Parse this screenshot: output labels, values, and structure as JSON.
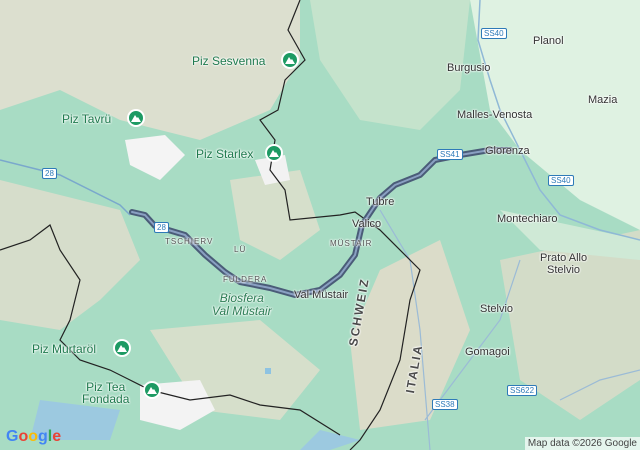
{
  "places": {
    "planol": "Planol",
    "burgusio": "Burgusio",
    "malles": "Malles-Venosta",
    "mazia": "Mazia",
    "glorenza": "Glorenza",
    "tubre": "Tubre",
    "valico": "Valico",
    "mustair_area": "MÜSTAIR",
    "tschierv": "TSCHIERV",
    "lu": "LÜ",
    "fuldera": "FULDERA",
    "val_mustair": "Val Müstair",
    "montechiaro": "Montechiaro",
    "prato": "Prato Allo\nStelvio",
    "stelvio": "Stelvio",
    "gomagoi": "Gomagoi"
  },
  "peaks": {
    "sesvenna": "Piz Sesvenna",
    "tavru": "Piz Tavrü",
    "starlex": "Piz Starlex",
    "murtarol": "Piz Murtaröl",
    "tea": "Piz Tea\nFondada"
  },
  "park": "Biosfera\nVal Müstair",
  "countries": {
    "ch": "SCHWEIZ",
    "it": "ITALIA"
  },
  "roads": {
    "ss40_top": "SS40",
    "ss41": "SS41",
    "ss40_right": "SS40",
    "r28": "28",
    "r28b": "28",
    "ss622": "SS622",
    "ss38": "SS38"
  },
  "branding": {
    "logo": "Google",
    "attribution": "Map data ©2026 Google"
  },
  "colors": {
    "route": "#4a5c78",
    "terrain": "#a8dcc4",
    "peak_marker": "#1d9a63"
  }
}
